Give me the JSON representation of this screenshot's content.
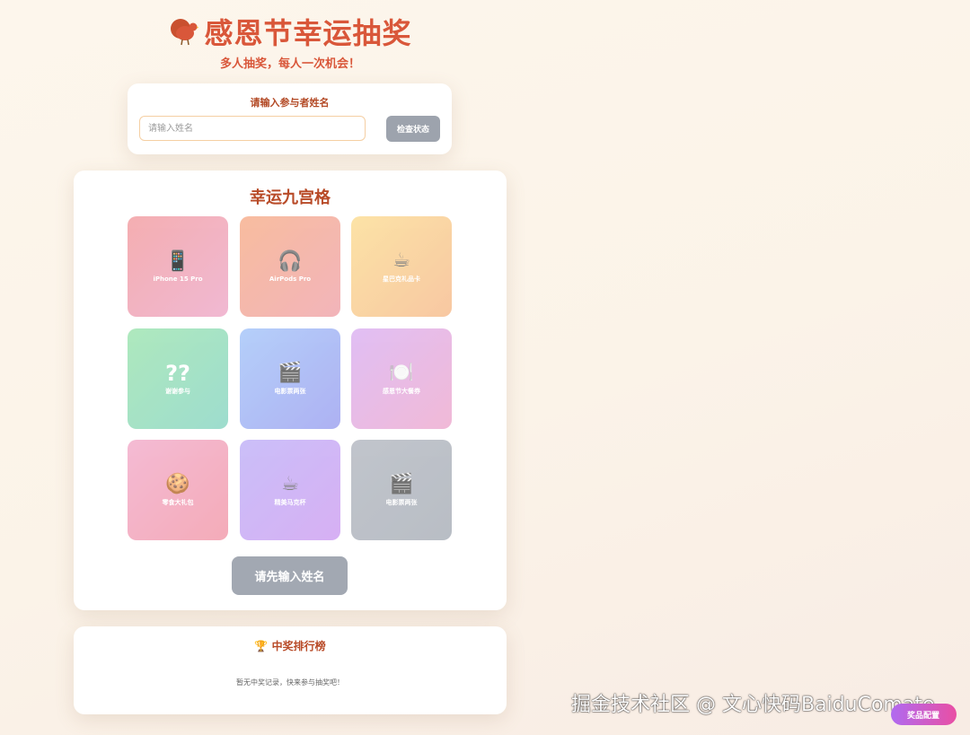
{
  "header": {
    "title": "感恩节幸运抽奖",
    "subtitle": "多人抽奖，每人一次机会！",
    "logo_icon": "turkey-icon",
    "title_color": "#d9573a"
  },
  "participant": {
    "label": "请输入参与者姓名",
    "input_value": "",
    "input_placeholder": "请输入姓名",
    "check_button": "检查状态"
  },
  "grid": {
    "title": "幸运九宫格",
    "cells": [
      {
        "emoji": "📱",
        "label": "iPhone 15 Pro",
        "icon": "phone-icon"
      },
      {
        "emoji": "🎧",
        "label": "AirPods Pro",
        "icon": "headphones-icon"
      },
      {
        "emoji": "☕",
        "label": "星巴克礼品卡",
        "icon": "coffee-icon"
      },
      {
        "emoji": "??",
        "label": "谢谢参与",
        "icon": "question-icon"
      },
      {
        "emoji": "🎬",
        "label": "电影票两张",
        "icon": "clapperboard-icon"
      },
      {
        "emoji": "🍽️",
        "label": "感恩节大餐券",
        "icon": "dinner-plate-icon"
      },
      {
        "emoji": "🍪",
        "label": "零食大礼包",
        "icon": "cookie-icon"
      },
      {
        "emoji": "☕",
        "label": "精美马克杯",
        "icon": "mug-icon"
      },
      {
        "emoji": "🎬",
        "label": "电影票两张",
        "icon": "clapperboard-icon"
      }
    ],
    "draw_button": "请先输入姓名"
  },
  "leaderboard": {
    "icon": "🏆",
    "title": "中奖排行榜",
    "empty_text": "暂无中奖记录，快来参与抽奖吧！"
  },
  "watermark": "掘金技术社区 @ 文心快码BaiduComate",
  "floating_button": "奖品配置"
}
